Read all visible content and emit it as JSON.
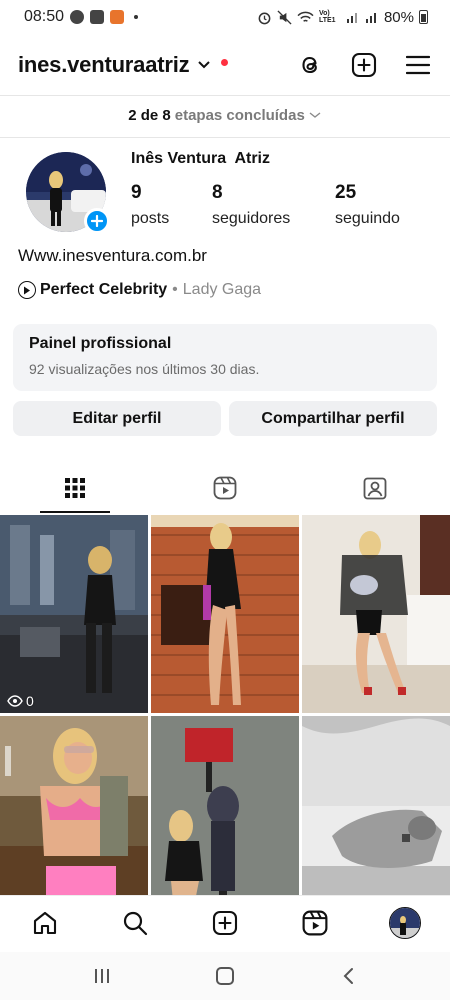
{
  "status_bar": {
    "time": "08:50",
    "battery": "80%",
    "network": "Vo) LTE1"
  },
  "header": {
    "username": "ines.venturaatriz",
    "icons": [
      "threads-icon",
      "plus-square-icon",
      "menu-icon"
    ]
  },
  "steps": {
    "done": "2 de 8",
    "label": "etapas concluídas"
  },
  "profile": {
    "display_name": "Inês Ventura  Atriz",
    "stats": [
      {
        "value": "9",
        "label": "posts"
      },
      {
        "value": "8",
        "label": "seguidores"
      },
      {
        "value": "25",
        "label": "seguindo"
      }
    ],
    "website": "Www.inesventura.com.br",
    "music": {
      "song": "Perfect Celebrity",
      "separator": "•",
      "artist": "Lady Gaga"
    }
  },
  "pro_panel": {
    "title": "Painel profissional",
    "subtitle": "92 visualizações nos últimos 30 dias."
  },
  "buttons": {
    "edit": "Editar perfil",
    "share": "Compartilhar perfil"
  },
  "tabs": [
    "grid-icon",
    "reels-icon",
    "tagged-icon"
  ],
  "posts": [
    {
      "views": "0"
    }
  ],
  "colors": {
    "accent_blue": "#0095f6",
    "notification_red": "#ff3040",
    "panel_bg": "#f3f4f6"
  }
}
